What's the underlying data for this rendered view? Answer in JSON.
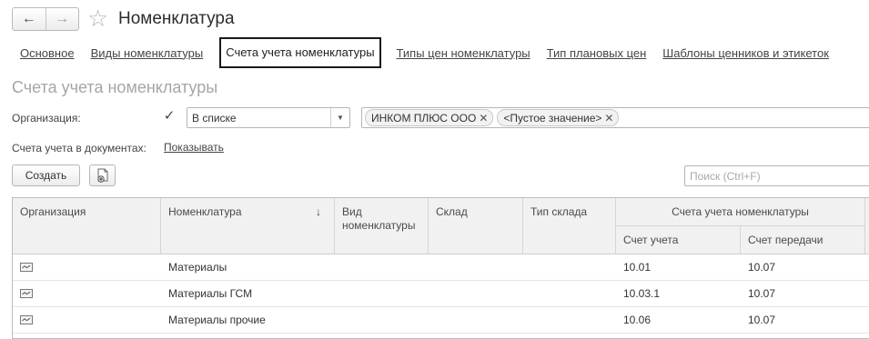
{
  "window": {
    "title": "Номенклатура",
    "back_icon": "arrow-left-icon",
    "forward_icon": "arrow-right-icon",
    "favorite_icon": "star-icon"
  },
  "tabs": [
    {
      "label": "Основное",
      "active": false
    },
    {
      "label": "Виды номенклатуры",
      "active": false
    },
    {
      "label": "Счета учета номенклатуры",
      "active": true
    },
    {
      "label": "Типы цен номенклатуры",
      "active": false
    },
    {
      "label": "Тип плановых цен",
      "active": false
    },
    {
      "label": "Шаблоны ценников и этикеток",
      "active": false
    }
  ],
  "section_title": "Счета учета номенклатуры",
  "filter": {
    "label": "Организация:",
    "checked": true,
    "condition": "В списке",
    "values": [
      "ИНКОМ ПЛЮС ООО",
      "<Пустое значение>"
    ]
  },
  "doc_accounts": {
    "label": "Счета учета в документах:",
    "link": "Показывать"
  },
  "toolbar": {
    "create_label": "Создать",
    "search_placeholder": "Поиск (Ctrl+F)"
  },
  "table": {
    "columns": {
      "org": "Организация",
      "item": "Номенклатура",
      "kind": "Вид номенклатуры",
      "warehouse": "Склад",
      "warehouse_type": "Тип склада",
      "group": "Счета учета номенклатуры",
      "account": "Счет учета",
      "transfer": "Счет передачи"
    },
    "rows": [
      {
        "org": "",
        "item": "Материалы",
        "kind": "",
        "warehouse": "",
        "warehouse_type": "",
        "account": "10.01",
        "transfer": "10.07"
      },
      {
        "org": "",
        "item": "Материалы ГСМ",
        "kind": "",
        "warehouse": "",
        "warehouse_type": "",
        "account": "10.03.1",
        "transfer": "10.07"
      },
      {
        "org": "",
        "item": "Материалы прочие",
        "kind": "",
        "warehouse": "",
        "warehouse_type": "",
        "account": "10.06",
        "transfer": "10.07"
      }
    ]
  }
}
